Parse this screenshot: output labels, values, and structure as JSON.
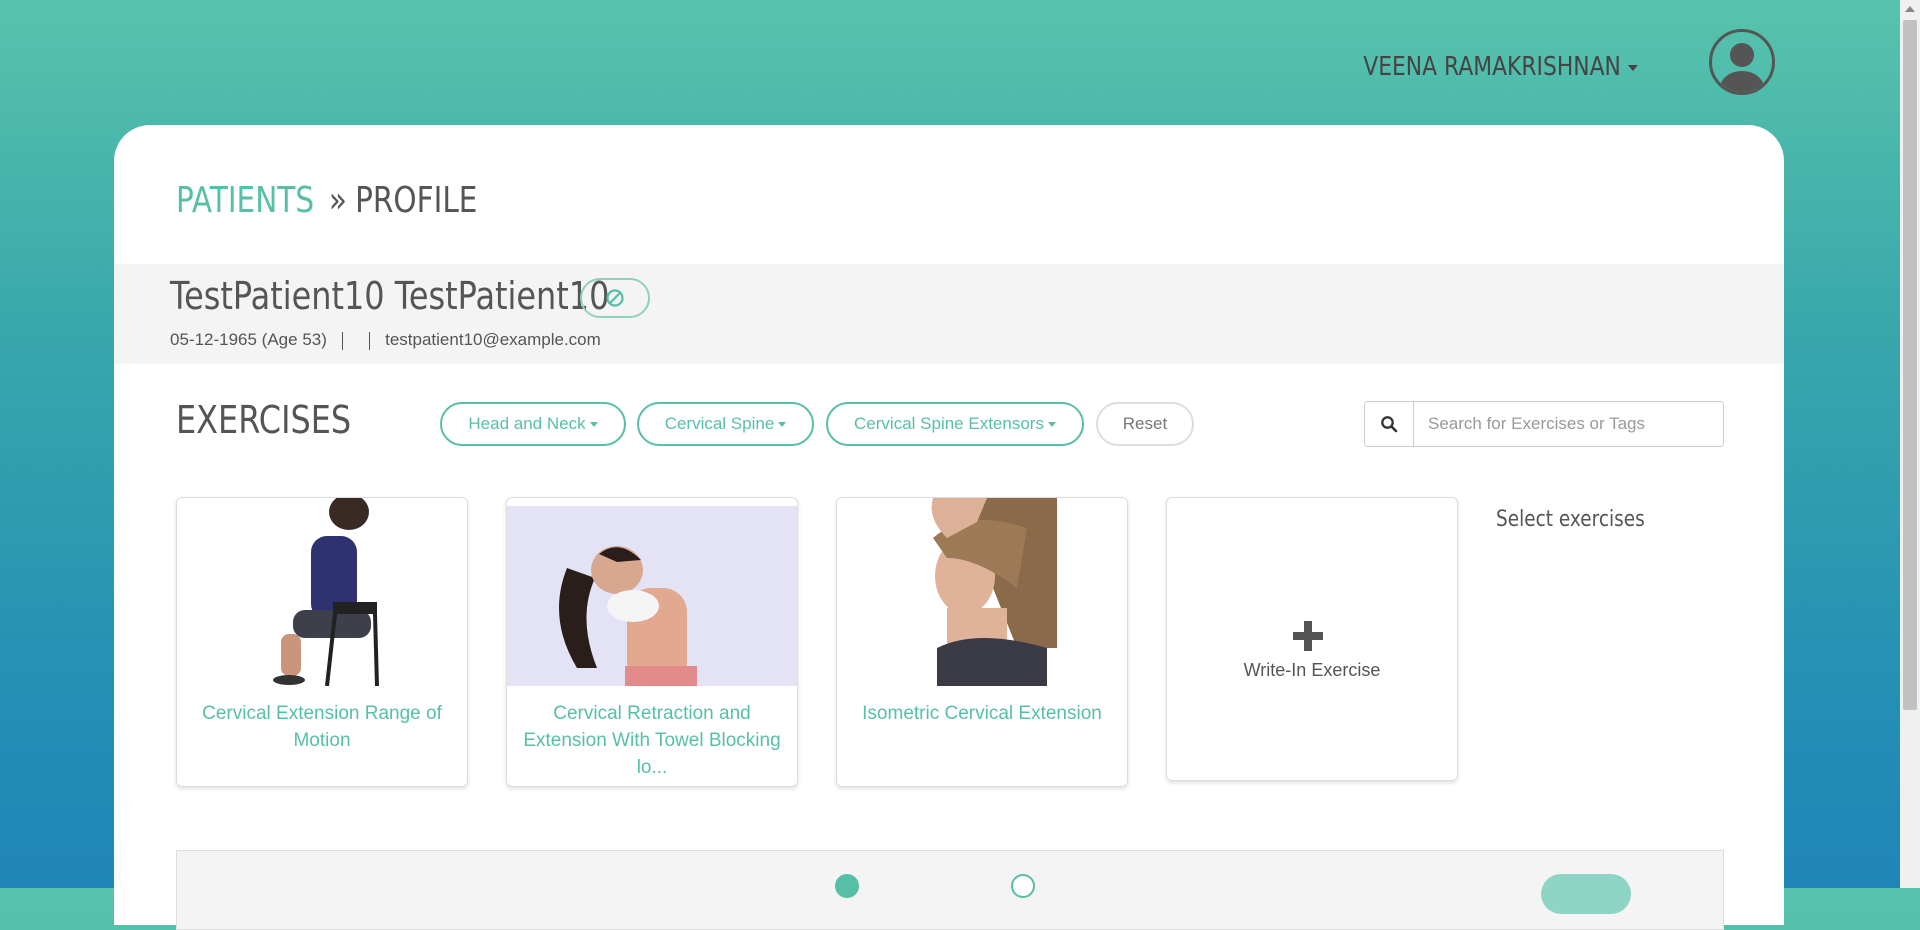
{
  "header": {
    "user_name": "VEENA RAMAKRISHNAN"
  },
  "breadcrumb": {
    "patients": "PATIENTS",
    "separator": "»",
    "current": "PROFILE"
  },
  "patient": {
    "name": "TestPatient10 TestPatient10",
    "status_icon": "ban-icon",
    "dob": "05-12-1965 (Age 53)",
    "email": "testpatient10@example.com"
  },
  "exercises": {
    "title": "EXERCISES",
    "filters": [
      "Head and Neck",
      "Cervical Spine",
      "Cervical Spine Extensors"
    ],
    "reset_label": "Reset",
    "search_placeholder": "Search for Exercises or Tags",
    "cards": [
      {
        "title": "Cervical Extension Range of Motion"
      },
      {
        "title": "Cervical Retraction and Extension With Towel Blocking lo..."
      },
      {
        "title": "Isometric Cervical Extension"
      }
    ],
    "write_in_label": "Write-In Exercise",
    "select_hint": "Select exercises"
  },
  "colors": {
    "accent": "#57bfa7",
    "text": "#555555",
    "band": "#f4f4f4"
  }
}
